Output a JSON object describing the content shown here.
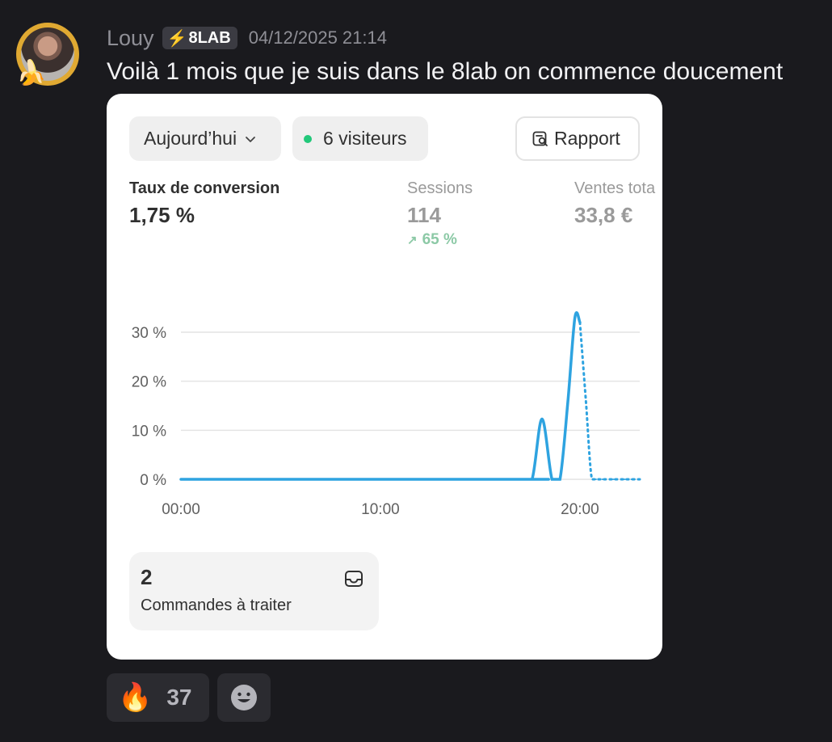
{
  "message": {
    "username": "Louy",
    "tag": "8LAB",
    "timestamp": "04/12/2025 21:14",
    "text": "Voilà 1 mois que je suis dans le 8lab on commence doucement"
  },
  "dashboard": {
    "date_filter": "Aujourd’hui",
    "visitors": "6 visiteurs",
    "report_button": "Rapport",
    "metrics": [
      {
        "label": "Taux de conversion",
        "value": "1,75 %"
      },
      {
        "label": "Sessions",
        "value": "114",
        "trend": "65 %"
      },
      {
        "label": "Ventes tota",
        "value": "33,8 €"
      }
    ],
    "orders_card": {
      "count": "2",
      "label": "Commandes à traiter"
    }
  },
  "chart_data": {
    "type": "line",
    "x_ticks": [
      "00:00",
      "10:00",
      "20:00"
    ],
    "y_ticks": [
      "0 %",
      "10 %",
      "20 %",
      "30 %"
    ],
    "ylim": [
      0,
      30
    ],
    "series": [
      {
        "style": "solid",
        "x": [
          0,
          17,
          17.6,
          18.1,
          18.6,
          19.0,
          19.4,
          19.75,
          20.0
        ],
        "values": [
          0,
          0,
          0,
          12.3,
          0,
          0,
          16,
          33,
          32
        ]
      },
      {
        "style": "dotted",
        "x": [
          20.0,
          20.3,
          20.6,
          21.0,
          23.0
        ],
        "values": [
          32,
          16,
          0,
          0,
          0
        ]
      }
    ],
    "grid": true,
    "color": "#2ea3e0"
  },
  "reactions": [
    {
      "emoji": "🔥",
      "count": "37"
    }
  ]
}
